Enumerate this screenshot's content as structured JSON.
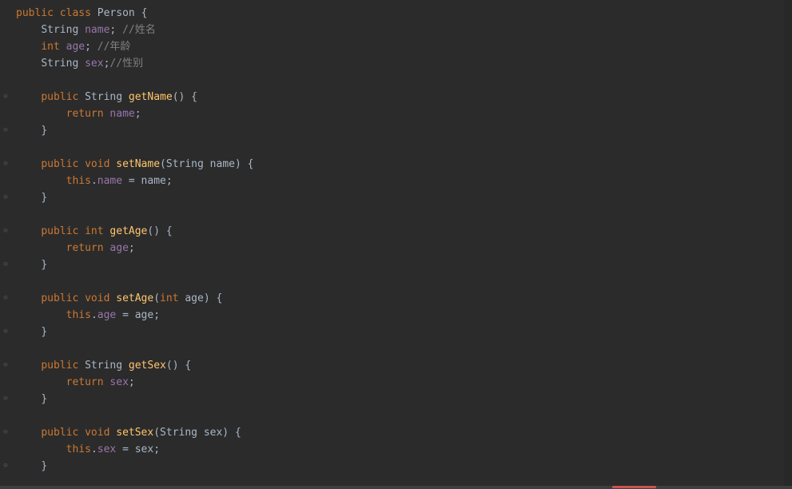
{
  "code": {
    "lines": [
      {
        "indent": 0,
        "segments": [
          {
            "t": "public ",
            "c": "kw"
          },
          {
            "t": "class ",
            "c": "kw"
          },
          {
            "t": "Person ",
            "c": "cls"
          },
          {
            "t": "{",
            "c": "punct"
          }
        ]
      },
      {
        "indent": 1,
        "segments": [
          {
            "t": "String ",
            "c": "type"
          },
          {
            "t": "name",
            "c": "field"
          },
          {
            "t": "; ",
            "c": "punct"
          },
          {
            "t": "//姓名",
            "c": "comment"
          }
        ]
      },
      {
        "indent": 1,
        "segments": [
          {
            "t": "int ",
            "c": "kw"
          },
          {
            "t": "age",
            "c": "field"
          },
          {
            "t": "; ",
            "c": "punct"
          },
          {
            "t": "//年龄",
            "c": "comment"
          }
        ]
      },
      {
        "indent": 1,
        "segments": [
          {
            "t": "String ",
            "c": "type"
          },
          {
            "t": "sex",
            "c": "field"
          },
          {
            "t": ";",
            "c": "punct"
          },
          {
            "t": "//性别",
            "c": "comment"
          }
        ]
      },
      {
        "indent": 0,
        "segments": []
      },
      {
        "indent": 1,
        "segments": [
          {
            "t": "public ",
            "c": "kw"
          },
          {
            "t": "String ",
            "c": "type"
          },
          {
            "t": "getName",
            "c": "method"
          },
          {
            "t": "() {",
            "c": "punct"
          }
        ]
      },
      {
        "indent": 2,
        "segments": [
          {
            "t": "return ",
            "c": "kw"
          },
          {
            "t": "name",
            "c": "field"
          },
          {
            "t": ";",
            "c": "punct"
          }
        ]
      },
      {
        "indent": 1,
        "segments": [
          {
            "t": "}",
            "c": "punct"
          }
        ]
      },
      {
        "indent": 0,
        "segments": []
      },
      {
        "indent": 1,
        "segments": [
          {
            "t": "public ",
            "c": "kw"
          },
          {
            "t": "void ",
            "c": "kw"
          },
          {
            "t": "setName",
            "c": "method"
          },
          {
            "t": "(String name) {",
            "c": "punct"
          }
        ]
      },
      {
        "indent": 2,
        "segments": [
          {
            "t": "this",
            "c": "kw"
          },
          {
            "t": ".",
            "c": "punct"
          },
          {
            "t": "name",
            "c": "field"
          },
          {
            "t": " = name;",
            "c": "punct"
          }
        ]
      },
      {
        "indent": 1,
        "segments": [
          {
            "t": "}",
            "c": "punct"
          }
        ]
      },
      {
        "indent": 0,
        "segments": []
      },
      {
        "indent": 1,
        "segments": [
          {
            "t": "public ",
            "c": "kw"
          },
          {
            "t": "int ",
            "c": "kw"
          },
          {
            "t": "getAge",
            "c": "method"
          },
          {
            "t": "() {",
            "c": "punct"
          }
        ]
      },
      {
        "indent": 2,
        "segments": [
          {
            "t": "return ",
            "c": "kw"
          },
          {
            "t": "age",
            "c": "field"
          },
          {
            "t": ";",
            "c": "punct"
          }
        ]
      },
      {
        "indent": 1,
        "segments": [
          {
            "t": "}",
            "c": "punct"
          }
        ]
      },
      {
        "indent": 0,
        "segments": []
      },
      {
        "indent": 1,
        "segments": [
          {
            "t": "public ",
            "c": "kw"
          },
          {
            "t": "void ",
            "c": "kw"
          },
          {
            "t": "setAge",
            "c": "method"
          },
          {
            "t": "(",
            "c": "punct"
          },
          {
            "t": "int ",
            "c": "kw"
          },
          {
            "t": "age) {",
            "c": "punct"
          }
        ]
      },
      {
        "indent": 2,
        "segments": [
          {
            "t": "this",
            "c": "kw"
          },
          {
            "t": ".",
            "c": "punct"
          },
          {
            "t": "age",
            "c": "field"
          },
          {
            "t": " = age;",
            "c": "punct"
          }
        ]
      },
      {
        "indent": 1,
        "segments": [
          {
            "t": "}",
            "c": "punct"
          }
        ]
      },
      {
        "indent": 0,
        "segments": []
      },
      {
        "indent": 1,
        "segments": [
          {
            "t": "public ",
            "c": "kw"
          },
          {
            "t": "String ",
            "c": "type"
          },
          {
            "t": "getSex",
            "c": "method"
          },
          {
            "t": "() {",
            "c": "punct"
          }
        ]
      },
      {
        "indent": 2,
        "segments": [
          {
            "t": "return ",
            "c": "kw"
          },
          {
            "t": "sex",
            "c": "field"
          },
          {
            "t": ";",
            "c": "punct"
          }
        ]
      },
      {
        "indent": 1,
        "segments": [
          {
            "t": "}",
            "c": "punct"
          }
        ]
      },
      {
        "indent": 0,
        "segments": []
      },
      {
        "indent": 1,
        "segments": [
          {
            "t": "public ",
            "c": "kw"
          },
          {
            "t": "void ",
            "c": "kw"
          },
          {
            "t": "setSex",
            "c": "method"
          },
          {
            "t": "(String sex) {",
            "c": "punct"
          }
        ]
      },
      {
        "indent": 2,
        "segments": [
          {
            "t": "this",
            "c": "kw"
          },
          {
            "t": ".",
            "c": "punct"
          },
          {
            "t": "sex",
            "c": "field"
          },
          {
            "t": " = sex;",
            "c": "punct"
          }
        ]
      },
      {
        "indent": 1,
        "segments": [
          {
            "t": "}",
            "c": "punct"
          }
        ]
      }
    ]
  },
  "gutter": {
    "marks": [
      "",
      "",
      "",
      "",
      "",
      "⊖",
      "",
      "⊖",
      "",
      "⊖",
      "",
      "⊖",
      "",
      "⊖",
      "",
      "⊖",
      "",
      "⊖",
      "",
      "⊖",
      "",
      "⊖",
      "",
      "⊖",
      "",
      "⊖",
      "",
      "⊖"
    ]
  }
}
